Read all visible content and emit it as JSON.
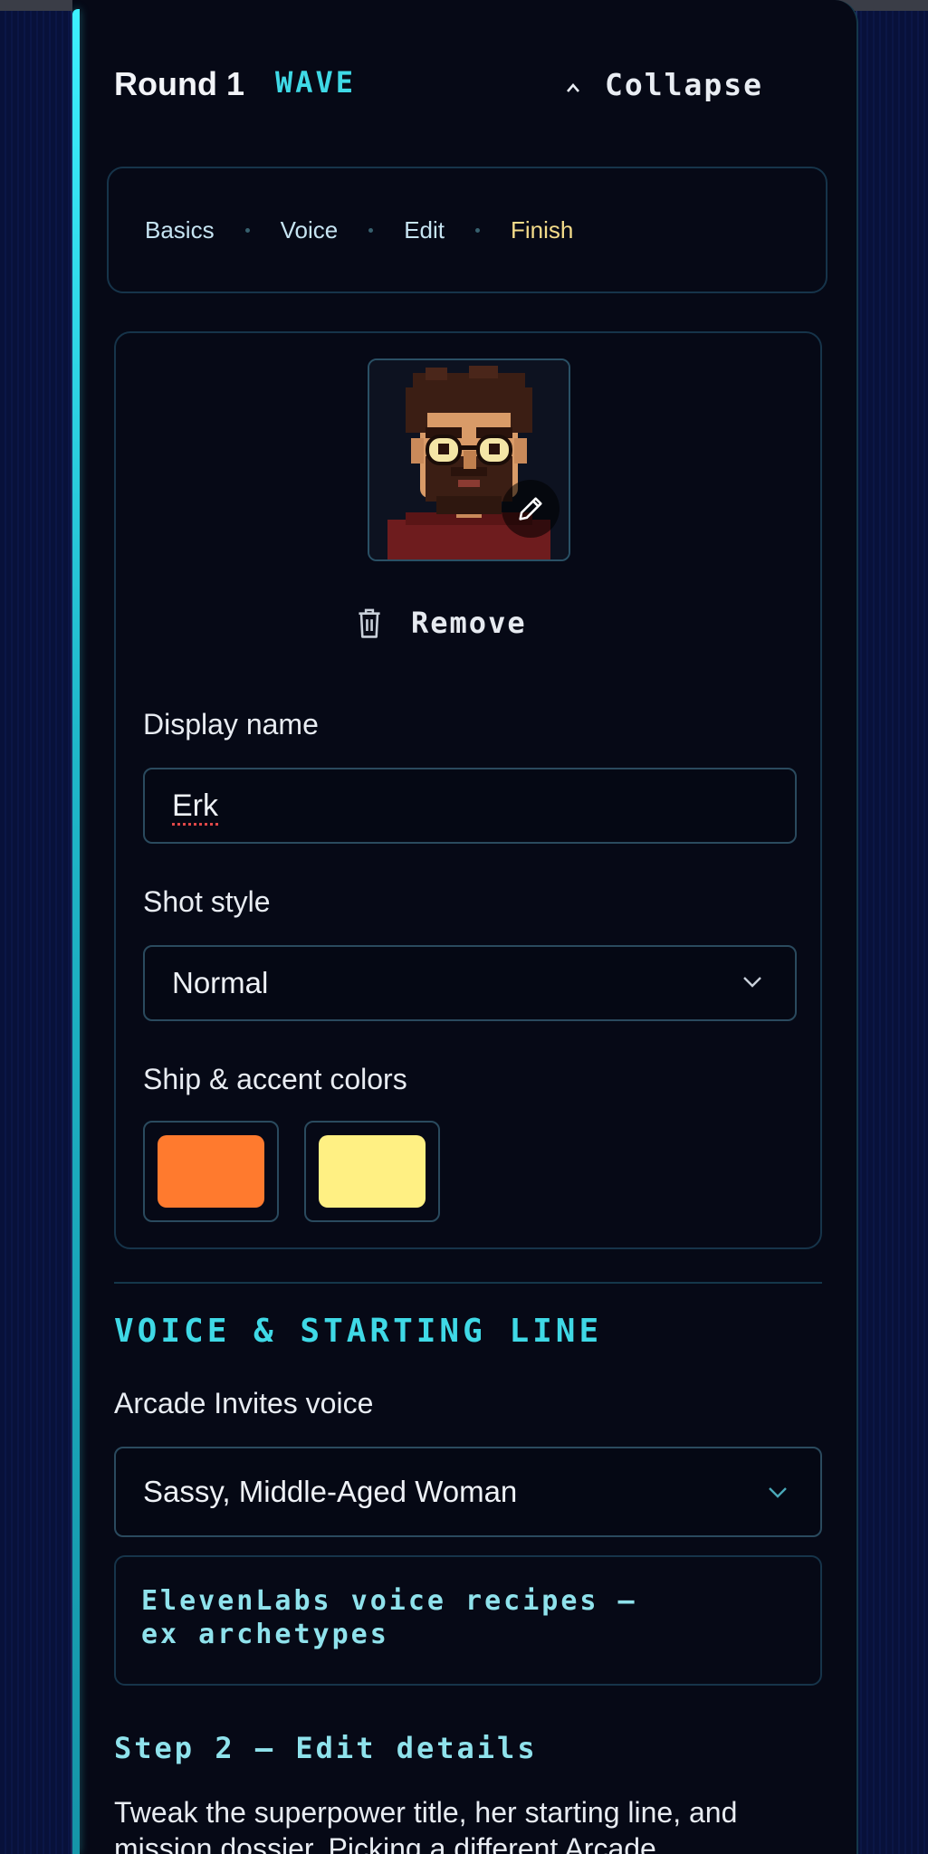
{
  "header": {
    "title": "Round 1",
    "tag": "WAVE",
    "collapse_label": "Collapse"
  },
  "steps": [
    "Basics",
    "Voice",
    "Edit",
    "Finish"
  ],
  "active_step": "Finish",
  "profile": {
    "remove_label": "Remove",
    "display_name_label": "Display name",
    "display_name_value": "Erk",
    "shot_style_label": "Shot style",
    "shot_style_value": "Normal",
    "colors_label": "Ship & accent colors",
    "colors": [
      "#ff7a2e",
      "#fff083"
    ]
  },
  "voice_section": {
    "title": "VOICE & STARTING LINE",
    "voice_label": "Arcade Invites voice",
    "voice_value": "Sassy, Middle-Aged Woman",
    "recipes_line1": "ElevenLabs voice recipes —",
    "recipes_line2": "ex archetypes"
  },
  "step2": {
    "title": "Step 2 — Edit details",
    "body": "Tweak the superpower title, her starting line, and mission dossier. Picking a different Arcade"
  },
  "icons": {
    "collapse": "chevron-up-icon",
    "edit": "pencil-icon",
    "remove": "trash-icon",
    "select": "chevron-down-icon"
  },
  "theme": {
    "accent_cyan": "#3fd9e6",
    "active_step_color": "#f4dc8a",
    "background": "#060916"
  }
}
